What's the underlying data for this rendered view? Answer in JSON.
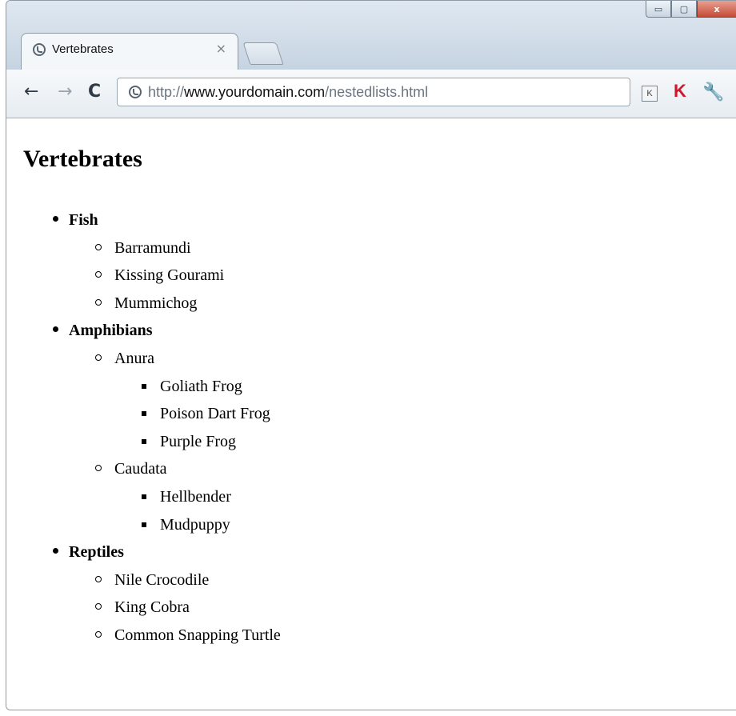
{
  "window": {
    "controls": {
      "minimize": "▭",
      "maximize": "▢",
      "close": "x"
    }
  },
  "tab": {
    "title": "Vertebrates",
    "close": "×"
  },
  "toolbar": {
    "back": "←",
    "forward": "→",
    "reload": "C",
    "url_prefix": "http://",
    "url_host": "www.yourdomain.com",
    "url_path": "/nestedlists.html",
    "ext_k": "K",
    "ext_kaspersky": "K",
    "wrench": "🔧"
  },
  "page": {
    "heading": "Vertebrates",
    "groups": [
      {
        "label": "Fish",
        "items": [
          {
            "label": "Barramundi"
          },
          {
            "label": "Kissing Gourami"
          },
          {
            "label": "Mummichog"
          }
        ]
      },
      {
        "label": "Amphibians",
        "items": [
          {
            "label": "Anura",
            "items": [
              "Goliath Frog",
              "Poison Dart Frog",
              "Purple Frog"
            ]
          },
          {
            "label": "Caudata",
            "items": [
              "Hellbender",
              "Mudpuppy"
            ]
          }
        ]
      },
      {
        "label": "Reptiles",
        "items": [
          {
            "label": "Nile Crocodile"
          },
          {
            "label": "King Cobra"
          },
          {
            "label": "Common Snapping Turtle"
          }
        ]
      }
    ]
  }
}
